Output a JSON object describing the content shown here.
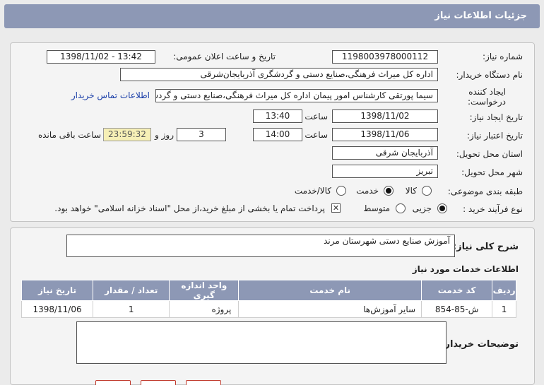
{
  "header": {
    "title": "جزئیات اطلاعات نیاز"
  },
  "form": {
    "need_number": {
      "label": "شماره نیاز:",
      "value": "1198003978000112"
    },
    "announce_datetime": {
      "label": "تاریخ و ساعت اعلان عمومی:",
      "value": "1398/11/02 - 13:42"
    },
    "buyer_org": {
      "label": "نام دستگاه خریدار:",
      "value": "اداره کل میراث فرهنگی،صنایع دستی و گردشگری آذربایجان‌شرقی"
    },
    "requester": {
      "label_line1": "ایجاد کننده",
      "label_line2": "درخواست:",
      "value": "سیما پورتقی کارشناس امور پیمان اداره کل میراث فرهنگی،صنایع دستی و گردشگری",
      "contact_link": "اطلاعات تماس خریدار"
    },
    "need_creation": {
      "label": "تاریخ ایجاد نیاز:",
      "date": "1398/11/02",
      "time_label": "ساعت",
      "time": "13:40"
    },
    "validity": {
      "label": "تاریخ اعتبار نیاز:",
      "date": "1398/11/06",
      "time_label": "ساعت",
      "time": "14:00",
      "days": "3",
      "days_label": "روز و",
      "remaining": "23:59:32",
      "remaining_label": "ساعت باقی مانده"
    },
    "province": {
      "label": "استان محل تحویل:",
      "value": "آذربایجان شرقی"
    },
    "city": {
      "label": "شهر محل تحویل:",
      "value": "تبریز"
    },
    "category": {
      "label": "طبقه بندی موضوعی:",
      "options": [
        "کالا",
        "خدمت",
        "کالا/خدمت"
      ],
      "selected": "خدمت"
    },
    "purchase_process": {
      "label": "نوع فرآیند خرید :",
      "options": [
        "جزیی",
        "متوسط"
      ],
      "selected": "جزیی",
      "payment_note": "پرداخت تمام یا بخشی از مبلغ خرید،از محل \"اسناد خزانه اسلامی\" خواهد بود."
    }
  },
  "description": {
    "label": "شرح کلی نیاز:",
    "value": "آموزش صنایع دستی شهرستان مرند"
  },
  "services": {
    "title": "اطلاعات خدمات مورد نیاز",
    "columns": [
      "ردیف",
      "کد خدمت",
      "نام خدمت",
      "واحد اندازه گیری",
      "تعداد / مقدار",
      "تاریخ نیاز"
    ],
    "rows": [
      [
        "1",
        "ش-85-854",
        "سایر آموزش‌ها",
        "پروژه",
        "1",
        "1398/11/06"
      ]
    ]
  },
  "buyer_notes": {
    "label": "توضیحات خریدار:",
    "value": ""
  },
  "colors": {
    "header_bg": "#8d98b5",
    "panel_bg": "#f4f4f4",
    "link": "#1a3ea8",
    "remaining_bg": "#f6efb6"
  }
}
